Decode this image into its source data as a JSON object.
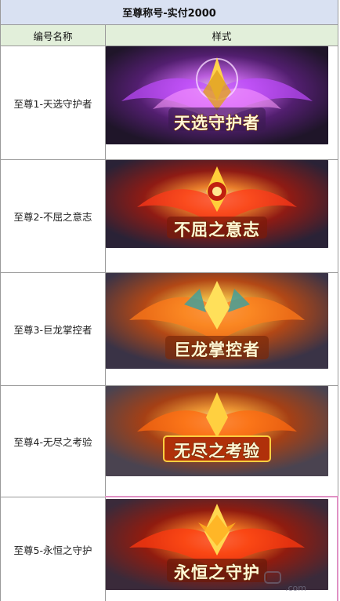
{
  "table": {
    "title": "至尊称号-实付2000",
    "header": {
      "name_col": "编号名称",
      "style_col": "样式"
    },
    "rows": [
      {
        "name": "至尊1-天选守护者",
        "badge_text": "天选守护者",
        "theme": "purple",
        "colors": {
          "bg": "#2a1838",
          "glow": "#c04cff",
          "core": "#ffd24a"
        }
      },
      {
        "name": "至尊2-不屈之意志",
        "badge_text": "不屈之意志",
        "theme": "red-fire",
        "colors": {
          "bg": "#2c2236",
          "glow": "#ff3a1a",
          "core": "#ffce3a"
        }
      },
      {
        "name": "至尊3-巨龙掌控者",
        "badge_text": "巨龙掌控者",
        "theme": "gold-fire",
        "colors": {
          "bg": "#3a3346",
          "glow": "#ff7a1a",
          "core": "#ffe05a"
        }
      },
      {
        "name": "至尊4-无尽之考验",
        "badge_text": "无尽之考验",
        "theme": "orange-fire",
        "colors": {
          "bg": "#4a4350",
          "glow": "#ff6a10",
          "core": "#ffd040"
        }
      },
      {
        "name": "至尊5-永恒之守护",
        "badge_text": "永恒之守护",
        "theme": "red-gold",
        "colors": {
          "bg": "#3a2a3a",
          "glow": "#ff3a10",
          "core": "#ffd850"
        }
      }
    ]
  },
  "watermark": {
    "text": ".com",
    "icon": "gamepad-icon"
  },
  "accent_colors": {
    "title_bg": "#d9e1f2",
    "header_bg": "#e2efda",
    "border": "#9a9a9a",
    "highlight_frame": "#e091c4"
  }
}
